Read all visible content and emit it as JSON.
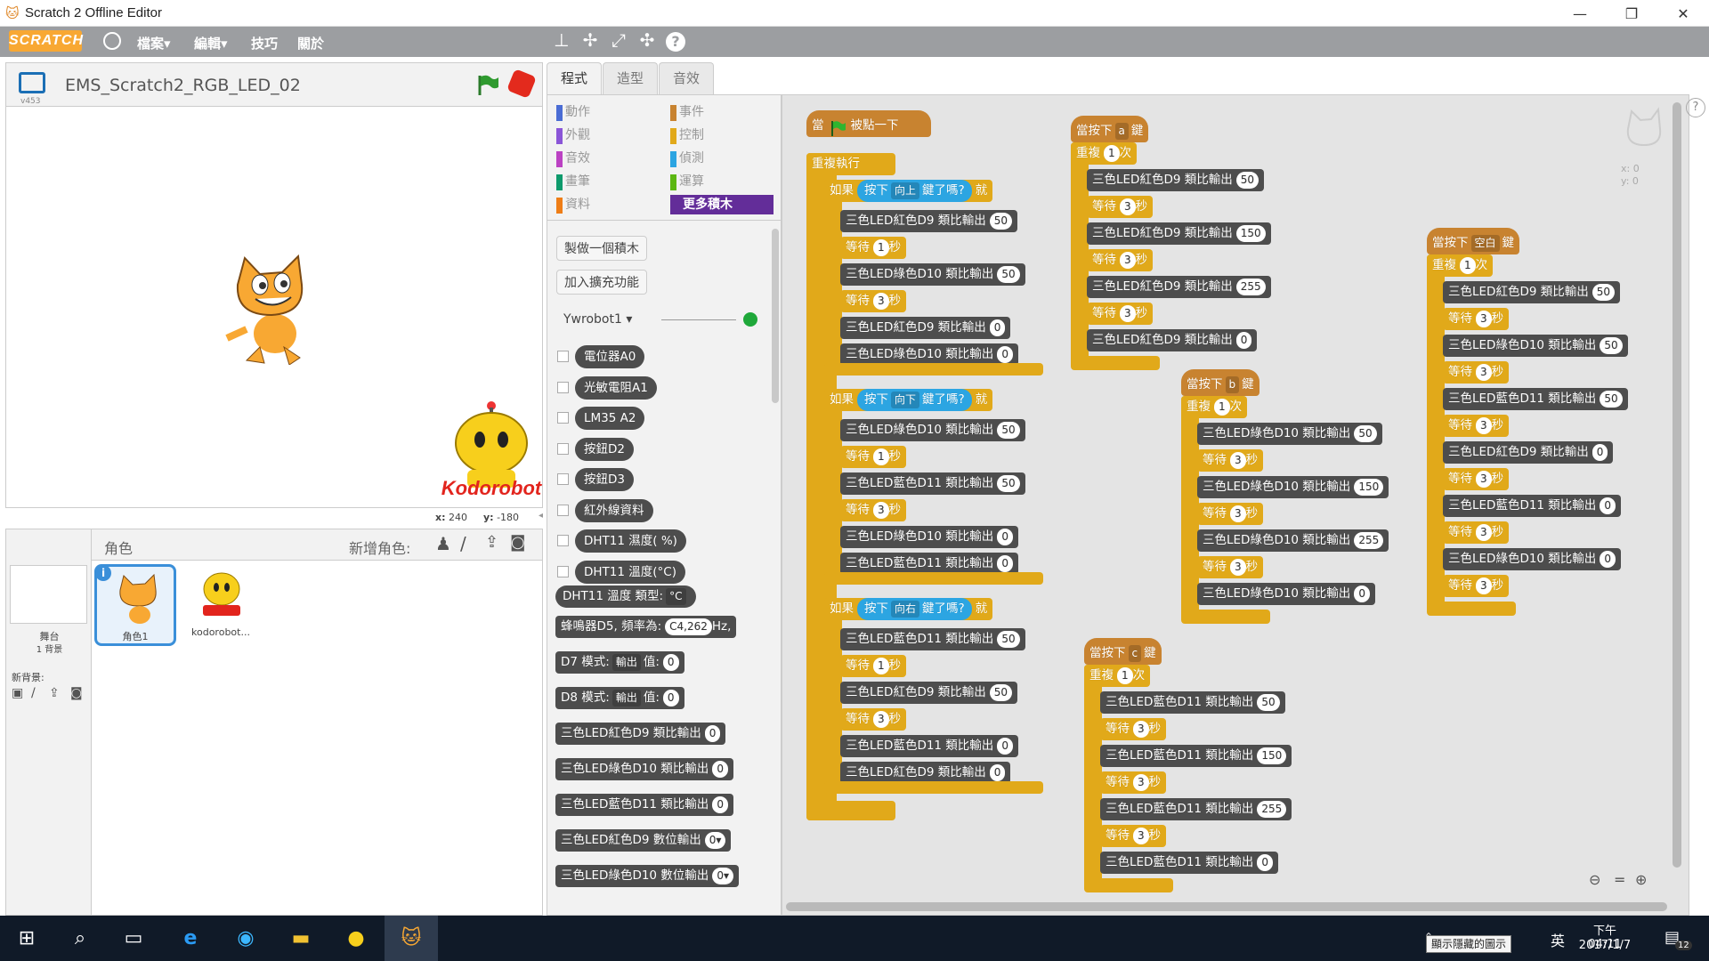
{
  "window": {
    "title": "Scratch 2 Offline Editor",
    "minimize": "—",
    "maximize": "❐",
    "close": "✕"
  },
  "menu": {
    "logo": "SCRATCH",
    "items": [
      "檔案▾",
      "編輯▾",
      "技巧",
      "關於"
    ],
    "tool_icons": [
      "stamp-icon",
      "cut-icon",
      "grow-icon",
      "shrink-icon",
      "help-icon"
    ]
  },
  "stage": {
    "project_title": "EMS_Scratch2_RGB_LED_02",
    "version": "v453",
    "x_label": "x:",
    "x_val": "240",
    "y_label": "y:",
    "y_val": "-180"
  },
  "sprites": {
    "header": "角色",
    "new_sprite": "新增角色:",
    "stage_label": "舞台",
    "stage_sub": "1 背景",
    "new_backdrop": "新背景:",
    "items": [
      {
        "name": "角色1"
      },
      {
        "name": "kodorobot..."
      }
    ]
  },
  "tabs": [
    "程式",
    "造型",
    "音效"
  ],
  "categories": {
    "left": [
      {
        "name": "動作",
        "color": "#4a6cd4"
      },
      {
        "name": "外觀",
        "color": "#8a55d7"
      },
      {
        "name": "音效",
        "color": "#bb42c3"
      },
      {
        "name": "畫筆",
        "color": "#0e9a6c"
      },
      {
        "name": "資料",
        "color": "#ee7d16"
      }
    ],
    "right": [
      {
        "name": "事件",
        "color": "#c88330"
      },
      {
        "name": "控制",
        "color": "#e1a91a"
      },
      {
        "name": "偵測",
        "color": "#2ca5e2"
      },
      {
        "name": "運算",
        "color": "#5cb712"
      },
      {
        "name": "更多積木",
        "color": "#632d99"
      }
    ]
  },
  "palette": {
    "make_block": "製做一個積木",
    "add_ext": "加入擴充功能",
    "ext_name": "Ywrobot1 ▾",
    "reporters": [
      "電位器A0",
      "光敏電阻A1",
      "LM35 A2",
      "按鈕D2",
      "按鈕D3",
      "紅外線資料",
      "DHT11 濕度( %)",
      "DHT11 溫度(°C)"
    ],
    "dht": "DHT11 溫度 類型:",
    "dht_opt": "°C",
    "buzzer": "蜂鳴器D5, 頻率為:",
    "buzzer_opt": "C4,262",
    "buzzer_hz": "Hz,",
    "d7": "D7 模式:",
    "d7_opt": "輸出",
    "d7_val_label": "值:",
    "d7_val": "0",
    "d8": "D8 模式:",
    "d8_opt": "輸出",
    "d8_val_label": "值:",
    "d8_val": "0",
    "cmds": [
      {
        "t": "三色LED紅色D9 類比輸出",
        "v": "0"
      },
      {
        "t": "三色LED綠色D10 類比輸出",
        "v": "0"
      },
      {
        "t": "三色LED藍色D11 類比輸出",
        "v": "0"
      },
      {
        "t": "三色LED紅色D9 數位輸出",
        "v": "0▾"
      },
      {
        "t": "三色LED綠色D10 數位輸出",
        "v": "0▾"
      }
    ]
  },
  "scripts": {
    "s1": {
      "hat_a": "當",
      "hat_b": "被點一下",
      "forever": "重複執行",
      "if": "如果",
      "press": "按下",
      "q": "鍵了嗎?",
      "then": "就",
      "keys": [
        "向上",
        "向下",
        "向右"
      ],
      "if1": [
        {
          "t": "三色LED紅色D9 類比輸出",
          "v": "50"
        },
        {
          "w": "1"
        },
        {
          "t": "三色LED綠色D10 類比輸出",
          "v": "50"
        },
        {
          "w": "3"
        },
        {
          "t": "三色LED紅色D9 類比輸出",
          "v": "0"
        },
        {
          "t": "三色LED綠色D10 類比輸出",
          "v": "0"
        }
      ],
      "if2": [
        {
          "t": "三色LED綠色D10 類比輸出",
          "v": "50"
        },
        {
          "w": "1"
        },
        {
          "t": "三色LED藍色D11 類比輸出",
          "v": "50"
        },
        {
          "w": "3"
        },
        {
          "t": "三色LED綠色D10 類比輸出",
          "v": "0"
        },
        {
          "t": "三色LED藍色D11 類比輸出",
          "v": "0"
        }
      ],
      "if3": [
        {
          "t": "三色LED藍色D11 類比輸出",
          "v": "50"
        },
        {
          "w": "1"
        },
        {
          "t": "三色LED紅色D9 類比輸出",
          "v": "50"
        },
        {
          "w": "3"
        },
        {
          "t": "三色LED藍色D11 類比輸出",
          "v": "0"
        },
        {
          "t": "三色LED紅色D9 類比輸出",
          "v": "0"
        }
      ]
    },
    "wait": "等待",
    "sec": "秒",
    "when_key": "當按下",
    "key_suffix": "鍵",
    "repeat": "重複",
    "times": "次",
    "s2": {
      "key": "a",
      "n": "1",
      "body": [
        {
          "t": "三色LED紅色D9 類比輸出",
          "v": "50"
        },
        {
          "w": "3"
        },
        {
          "t": "三色LED紅色D9 類比輸出",
          "v": "150"
        },
        {
          "w": "3"
        },
        {
          "t": "三色LED紅色D9 類比輸出",
          "v": "255"
        },
        {
          "w": "3"
        },
        {
          "t": "三色LED紅色D9 類比輸出",
          "v": "0"
        }
      ]
    },
    "s3": {
      "key": "b",
      "n": "1",
      "body": [
        {
          "t": "三色LED綠色D10 類比輸出",
          "v": "50"
        },
        {
          "w": "3"
        },
        {
          "t": "三色LED綠色D10 類比輸出",
          "v": "150"
        },
        {
          "w": "3"
        },
        {
          "t": "三色LED綠色D10 類比輸出",
          "v": "255"
        },
        {
          "w": "3"
        },
        {
          "t": "三色LED綠色D10 類比輸出",
          "v": "0"
        }
      ]
    },
    "s4": {
      "key": "c",
      "n": "1",
      "body": [
        {
          "t": "三色LED藍色D11 類比輸出",
          "v": "50"
        },
        {
          "w": "3"
        },
        {
          "t": "三色LED藍色D11 類比輸出",
          "v": "150"
        },
        {
          "w": "3"
        },
        {
          "t": "三色LED藍色D11 類比輸出",
          "v": "255"
        },
        {
          "w": "3"
        },
        {
          "t": "三色LED藍色D11 類比輸出",
          "v": "0"
        }
      ]
    },
    "s5": {
      "key": "空白",
      "n": "1",
      "body": [
        {
          "t": "三色LED紅色D9 類比輸出",
          "v": "50"
        },
        {
          "w": "3"
        },
        {
          "t": "三色LED綠色D10 類比輸出",
          "v": "50"
        },
        {
          "w": "3"
        },
        {
          "t": "三色LED藍色D11 類比輸出",
          "v": "50"
        },
        {
          "w": "3"
        },
        {
          "t": "三色LED紅色D9 類比輸出",
          "v": "0"
        },
        {
          "w": "3"
        },
        {
          "t": "三色LED藍色D11 類比輸出",
          "v": "0"
        },
        {
          "w": "3"
        },
        {
          "t": "三色LED綠色D10 類比輸出",
          "v": "0"
        },
        {
          "w": "3"
        }
      ]
    },
    "sprite_x": "x: 0",
    "sprite_y": "y: 0"
  },
  "taskbar": {
    "tooltip": "顯示隱藏的圖示",
    "ime": "英",
    "time": "下午 04:11",
    "date": "2017/1/7",
    "notif": "12"
  }
}
